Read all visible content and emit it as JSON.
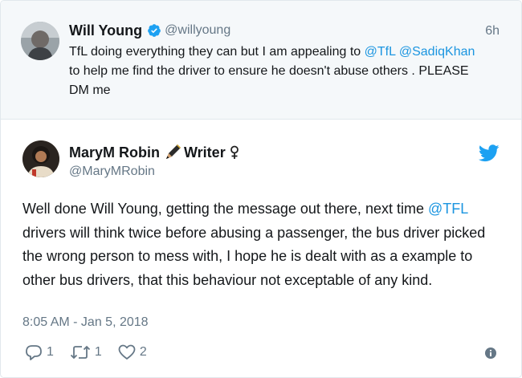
{
  "parent_tweet": {
    "author_name": "Will Young",
    "author_handle": "@willyoung",
    "time": "6h",
    "text_before": "TfL doing everything they can but I am appealing to ",
    "mention1": "@TfL",
    "text_between": " ",
    "mention2": "@SadiqKhan",
    "text_after": " to help me find the driver to ensure he doesn't abuse others . PLEASE DM me",
    "verified_icon": "verified-badge-icon"
  },
  "tweet": {
    "author_name": "MaryM Robin",
    "author_name_suffix": "Writer",
    "author_handle": "@MaryMRobin",
    "text_before": "Well done Will Young, getting the message out there, next time ",
    "mention": "@TFL",
    "text_after": " drivers will think twice before abusing a passenger, the bus driver picked the wrong person to mess with, I hope he is dealt with as a example to other bus drivers, that this behaviour not exceptable of any kind.",
    "timestamp": "8:05 AM - Jan 5, 2018",
    "reply_count": "1",
    "retweet_count": "1",
    "like_count": "2"
  },
  "colors": {
    "link": "#1b95e0",
    "muted": "#657786",
    "text": "#14171a",
    "parent_bg": "#f5f8fa",
    "brand": "#1da1f2"
  }
}
